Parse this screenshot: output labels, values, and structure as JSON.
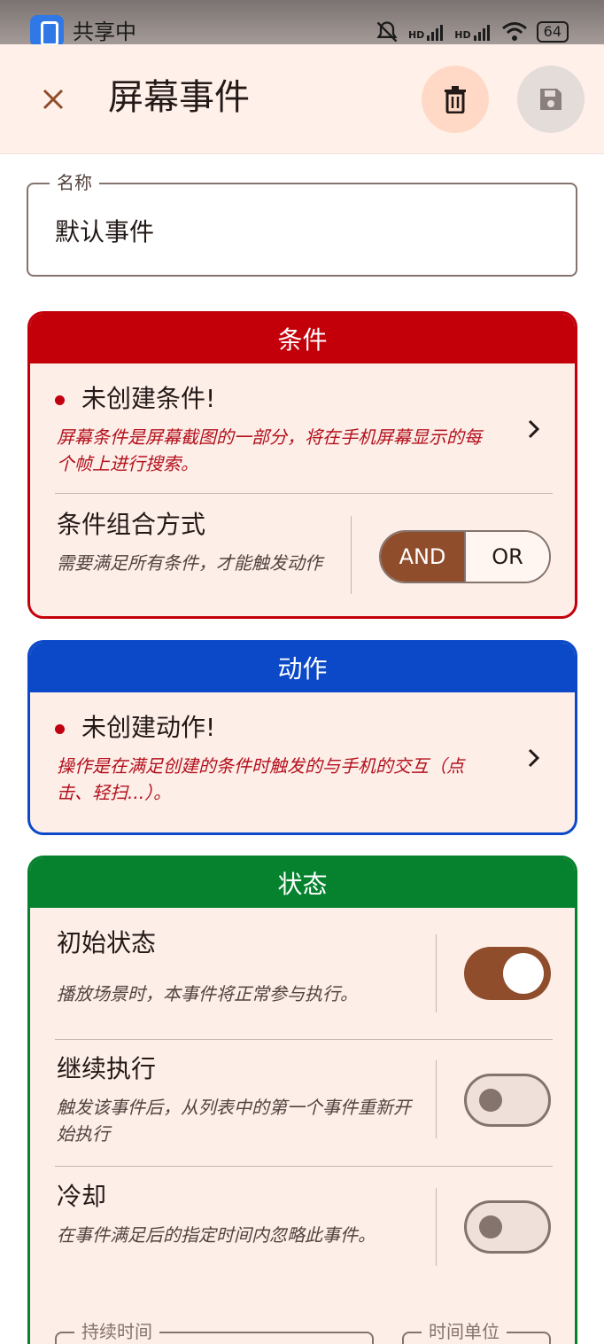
{
  "status_bar": {
    "share_label": "共享中",
    "hd_1": "HD",
    "hd_2": "HD",
    "battery": "64"
  },
  "toolbar": {
    "title": "屏幕事件"
  },
  "name_field": {
    "label": "名称",
    "value": "默认事件"
  },
  "conditions": {
    "header": "条件",
    "warning_title": "未创建条件!",
    "warning_desc": "屏幕条件是屏幕截图的一部分，将在手机屏幕显示的每个帧上进行搜索。",
    "combine_title": "条件组合方式",
    "combine_desc": "需要满足所有条件，才能触发动作",
    "combine_options": [
      "AND",
      "OR"
    ],
    "combine_selected": "AND"
  },
  "actions": {
    "header": "动作",
    "warning_title": "未创建动作!",
    "warning_desc": "操作是在满足创建的条件时触发的与手机的交互（点击、轻扫...）。"
  },
  "state": {
    "header": "状态",
    "items": [
      {
        "title": "初始状态",
        "desc": "播放场景时，本事件将正常参与执行。",
        "enabled": true
      },
      {
        "title": "继续执行",
        "desc": "触发该事件后，从列表中的第一个事件重新开始执行",
        "enabled": false
      },
      {
        "title": "冷却",
        "desc": "在事件满足后的指定时间内忽略此事件。",
        "enabled": false
      }
    ],
    "duration_label": "持续时间",
    "unit_label": "时间单位"
  },
  "colors": {
    "condition_accent": "#c3000a",
    "action_accent": "#0b49c9",
    "state_accent": "#06822e",
    "primary": "#8f4d2b"
  }
}
